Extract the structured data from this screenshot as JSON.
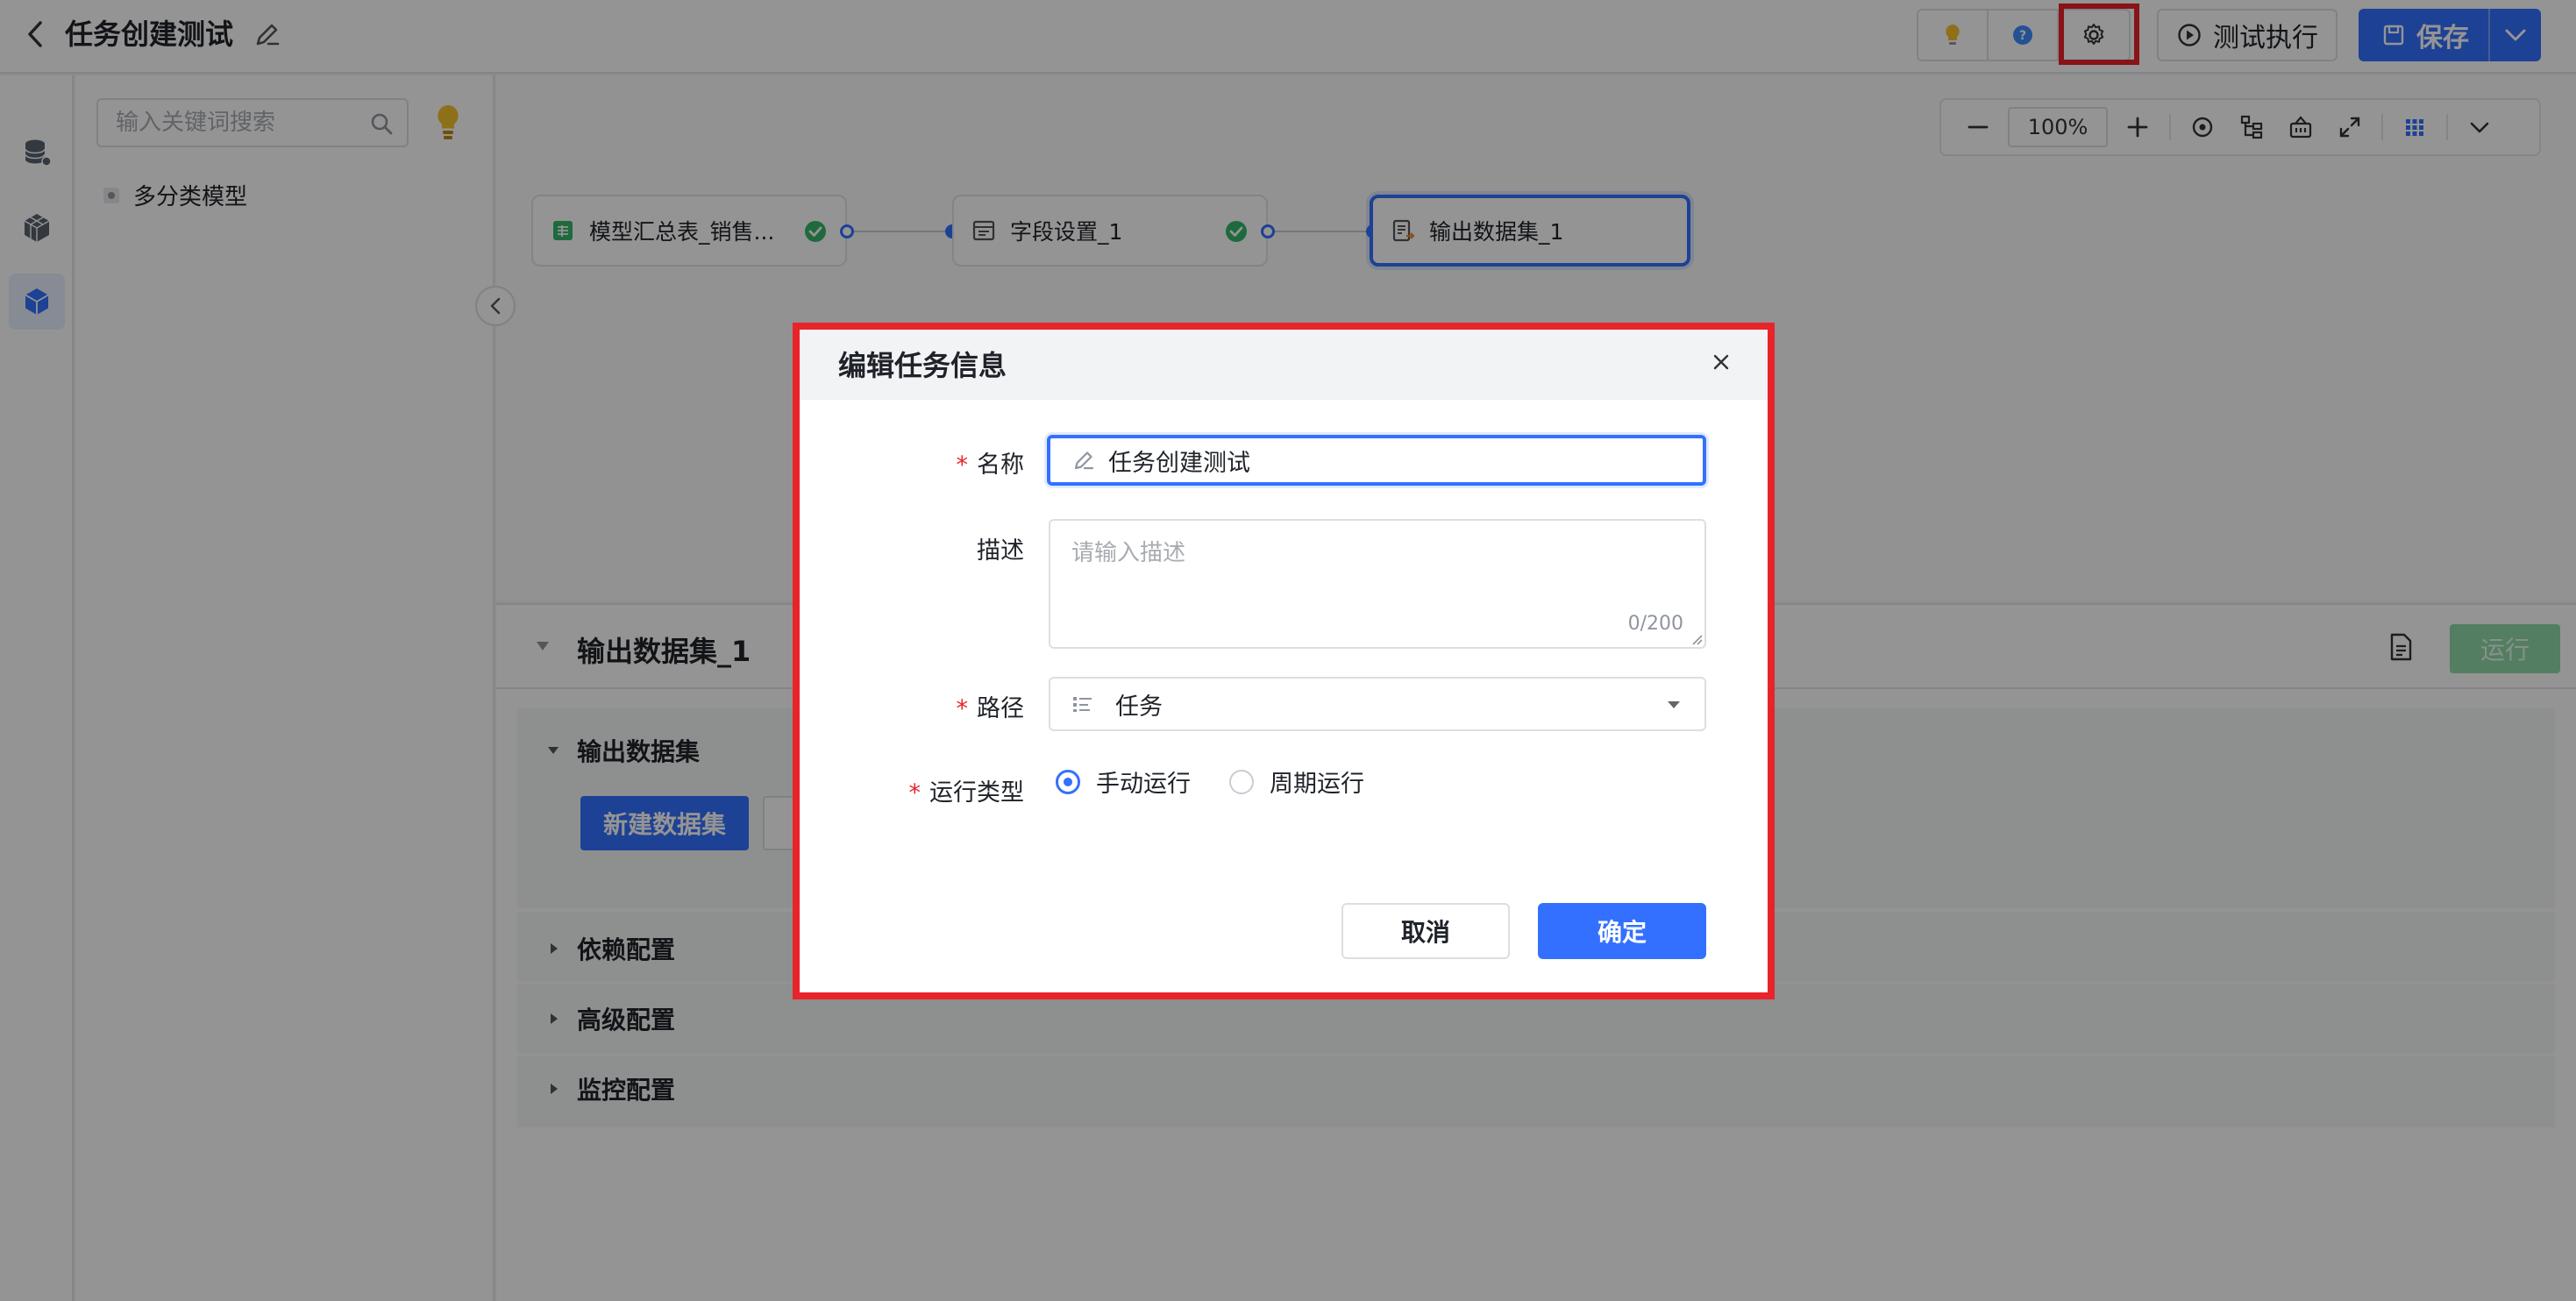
{
  "header": {
    "title": "任务创建测试",
    "test_run_label": "测试执行",
    "save_label": "保存"
  },
  "tree": {
    "search_placeholder": "输入关键词搜索",
    "nodes": [
      {
        "label": "多分类模型"
      }
    ]
  },
  "canvas": {
    "zoom": "100%",
    "flow_nodes": [
      {
        "label": "模型汇总表_销售...",
        "status": "success"
      },
      {
        "label": "字段设置_1",
        "status": "success"
      },
      {
        "label": "输出数据集_1",
        "status": "selected"
      }
    ]
  },
  "bottom_panel": {
    "title": "输出数据集_1",
    "run_label": "运行",
    "sections": [
      {
        "label": "输出数据集",
        "expanded": true
      },
      {
        "label": "依赖配置",
        "expanded": false
      },
      {
        "label": "高级配置",
        "expanded": false
      },
      {
        "label": "监控配置",
        "expanded": false
      }
    ],
    "new_dataset_label": "新建数据集"
  },
  "modal": {
    "title": "编辑任务信息",
    "fields": {
      "name_label": "名称",
      "name_value": "任务创建测试",
      "desc_label": "描述",
      "desc_placeholder": "请输入描述",
      "desc_count": "0/200",
      "path_label": "路径",
      "path_value": "任务",
      "run_type_label": "运行类型",
      "run_type_options": [
        {
          "label": "手动运行",
          "selected": true
        },
        {
          "label": "周期运行",
          "selected": false
        }
      ]
    },
    "cancel_label": "取消",
    "ok_label": "确定"
  },
  "colors": {
    "primary": "#3370ff",
    "success": "#34b76a",
    "highlight": "#e8232a",
    "required": "#e8232a"
  }
}
